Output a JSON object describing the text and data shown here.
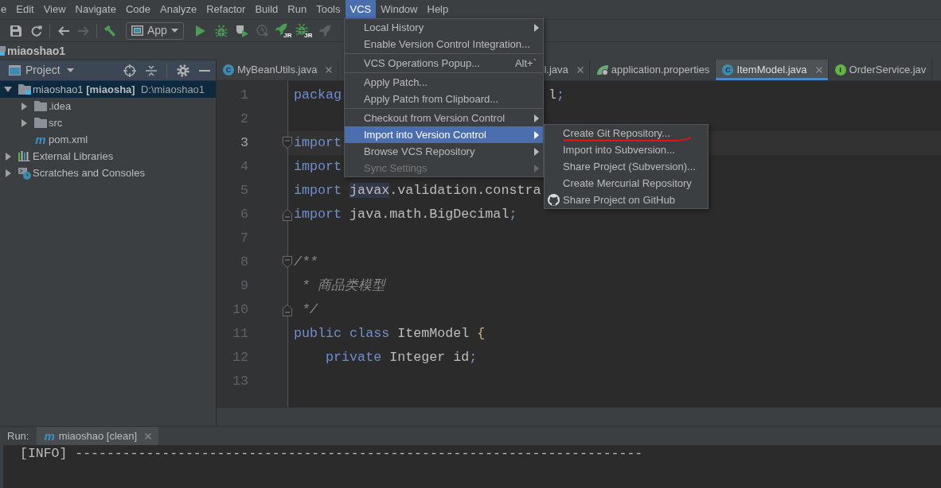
{
  "menu_bar": [
    {
      "label": "e",
      "selected": false
    },
    {
      "label": "Edit",
      "selected": false
    },
    {
      "label": "View",
      "selected": false
    },
    {
      "label": "Navigate",
      "selected": false
    },
    {
      "label": "Code",
      "selected": false
    },
    {
      "label": "Analyze",
      "selected": false
    },
    {
      "label": "Refactor",
      "selected": false
    },
    {
      "label": "Build",
      "selected": false
    },
    {
      "label": "Run",
      "selected": false
    },
    {
      "label": "Tools",
      "selected": false
    },
    {
      "label": "VCS",
      "selected": true
    },
    {
      "label": "Window",
      "selected": false
    },
    {
      "label": "Help",
      "selected": false
    }
  ],
  "toolbar": {
    "groups": [
      [
        {
          "kind": "save",
          "disabled": false
        },
        {
          "kind": "sync",
          "disabled": false
        }
      ],
      [
        {
          "kind": "back",
          "disabled": false
        },
        {
          "kind": "forward",
          "disabled": true
        }
      ],
      [
        {
          "kind": "build",
          "disabled": false
        },
        {
          "kind": "run-config",
          "label": "App"
        },
        {
          "kind": "run",
          "disabled": false
        },
        {
          "kind": "debug",
          "disabled": false
        },
        {
          "kind": "coverage",
          "disabled": false
        },
        {
          "kind": "profile",
          "disabled": true
        },
        {
          "kind": "rebel-run",
          "badge": "JR",
          "disabled": false
        },
        {
          "kind": "rebel-debug",
          "badge": "JR",
          "disabled": false
        },
        {
          "kind": "rebel-agent",
          "disabled": true
        }
      ]
    ]
  },
  "navigation_bar": {
    "label": "miaoshao1"
  },
  "project_panel": {
    "title": "Project",
    "tree": [
      {
        "kind": "module",
        "label": "miaoshao1",
        "module": "[miaosha]",
        "path": "D:\\miaoshao1",
        "expanded": true,
        "selected": true,
        "children": [
          {
            "kind": "folder",
            "label": ".idea",
            "expanded": false,
            "selected": false
          },
          {
            "kind": "folder",
            "label": "src",
            "expanded": false,
            "selected": false
          },
          {
            "kind": "maven",
            "icon_text": "m",
            "label": "pom.xml",
            "selected": false
          }
        ]
      },
      {
        "kind": "libraries",
        "label": "External Libraries",
        "expanded": false,
        "selected": false
      },
      {
        "kind": "scratches",
        "label": "Scratches and Consoles",
        "expanded": false,
        "selected": false
      }
    ]
  },
  "editor": {
    "tabs": [
      {
        "kind": "class",
        "letter": "C",
        "label": "MyBeanUtils.java",
        "closable": true,
        "selected": false
      },
      {
        "label": "l.java",
        "closable": true,
        "selected": false
      },
      {
        "kind": "spring",
        "label": "application.properties",
        "closable": false,
        "selected": false
      },
      {
        "kind": "class",
        "letter": "C",
        "label": "ItemModel.java",
        "closable": true,
        "selected": true
      },
      {
        "kind": "interface",
        "letter": "I",
        "label": "OrderService.jav",
        "closable": false,
        "selected": false
      }
    ],
    "lines": [
      {
        "number": "1",
        "current": false,
        "tokens": [
          {
            "kind": "keyword",
            "text": "packag"
          },
          {
            "kind": "gap"
          },
          {
            "kind": "plain",
            "text": "l"
          },
          {
            "kind": "punct",
            "text": ";"
          }
        ]
      },
      {
        "number": "2",
        "current": false
      },
      {
        "number": "3",
        "current": true,
        "fold": {
          "kind": "start"
        },
        "tokens": [
          {
            "kind": "keyword",
            "text": "import"
          }
        ]
      },
      {
        "number": "4",
        "current": false,
        "tokens": [
          {
            "kind": "keyword",
            "text": "import"
          }
        ]
      },
      {
        "number": "5",
        "current": false,
        "tokens": [
          {
            "kind": "keyword",
            "text": "import "
          },
          {
            "kind": "match",
            "text": "javax"
          },
          {
            "kind": "plain",
            "text": ".validation.constra"
          }
        ]
      },
      {
        "number": "6",
        "current": false,
        "fold": {
          "kind": "end"
        },
        "tokens": [
          {
            "kind": "keyword",
            "text": "import"
          },
          {
            "kind": "plain",
            "text": " java.math.BigDecimal"
          },
          {
            "kind": "punct",
            "text": ";"
          }
        ]
      },
      {
        "number": "7",
        "current": false
      },
      {
        "number": "8",
        "current": false,
        "fold": {
          "kind": "start"
        },
        "tokens": [
          {
            "kind": "comment",
            "text": "/**"
          }
        ]
      },
      {
        "number": "9",
        "current": false,
        "tokens": [
          {
            "kind": "comment",
            "text": " * 商品类模型"
          }
        ]
      },
      {
        "number": "10",
        "current": false,
        "fold": {
          "kind": "end"
        },
        "tokens": [
          {
            "kind": "comment",
            "text": " */"
          }
        ]
      },
      {
        "number": "11",
        "current": false,
        "tokens": [
          {
            "kind": "keyword",
            "text": "public class"
          },
          {
            "kind": "plain",
            "text": " ItemModel "
          },
          {
            "kind": "brace",
            "text": "{"
          }
        ]
      },
      {
        "number": "12",
        "current": false,
        "tokens": [
          {
            "kind": "keyword",
            "text": "    private"
          },
          {
            "kind": "plain",
            "text": " Integer id"
          },
          {
            "kind": "punct",
            "text": ";"
          }
        ]
      },
      {
        "number": "13",
        "current": false
      }
    ]
  },
  "run_panel": {
    "title": "Run:",
    "tabs": [
      {
        "icon_text": "m",
        "label": "miaoshao [clean]",
        "closable": true,
        "selected": true
      }
    ],
    "console": [
      "[INFO] ------------------------------------------------------------------------"
    ]
  },
  "vcs_menu": {
    "groups": [
      [
        {
          "label": "Local History",
          "submenu": true,
          "selected": false,
          "disabled": false
        },
        {
          "label": "Enable Version Control Integration...",
          "submenu": false,
          "selected": false,
          "disabled": false
        }
      ],
      [
        {
          "label": "VCS Operations Popup...",
          "shortcut": "Alt+`",
          "submenu": false,
          "selected": false,
          "disabled": false
        }
      ],
      [
        {
          "label": "Apply Patch...",
          "submenu": false,
          "selected": false,
          "disabled": false
        },
        {
          "label": "Apply Patch from Clipboard...",
          "submenu": false,
          "selected": false,
          "disabled": false
        }
      ],
      [
        {
          "label": "Checkout from Version Control",
          "submenu": true,
          "selected": false,
          "disabled": false
        },
        {
          "label": "Import into Version Control",
          "submenu": true,
          "selected": true,
          "disabled": false
        },
        {
          "label": "Browse VCS Repository",
          "submenu": true,
          "selected": false,
          "disabled": false
        },
        {
          "label": "Sync Settings",
          "submenu": true,
          "selected": false,
          "disabled": true
        }
      ]
    ]
  },
  "import_submenu": {
    "items": [
      {
        "label": "Create Git Repository...",
        "underlined": true,
        "has_icon": false
      },
      {
        "label": "Import into Subversion...",
        "underlined": false,
        "has_icon": false
      },
      {
        "label": "Share Project (Subversion)...",
        "underlined": false,
        "has_icon": false
      },
      {
        "label": "Create Mercurial Repository",
        "underlined": false,
        "has_icon": false
      },
      {
        "label": "Share Project on GitHub",
        "underlined": false,
        "has_icon": true
      }
    ]
  }
}
